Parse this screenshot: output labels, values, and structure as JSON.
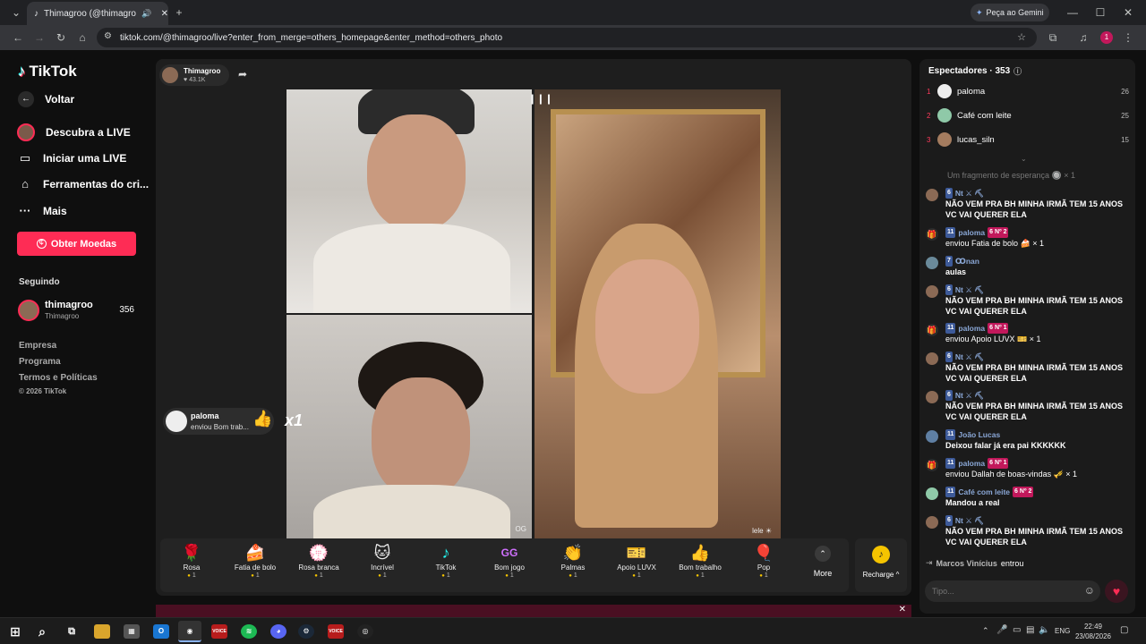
{
  "browser": {
    "tab_title": "Thimagroo (@thimagroo) o",
    "new_tab": "+",
    "gemini": "Peça ao Gemini",
    "url": "tiktok.com/@thimagroo/live?enter_from_merge=others_homepage&enter_method=others_photo",
    "profile_initial": "1"
  },
  "sidebar": {
    "logo": "TikTok",
    "back": "Voltar",
    "items": [
      {
        "label": "Descubra a LIVE",
        "icon": "live-avatar-icon"
      },
      {
        "label": "Iniciar uma LIVE",
        "icon": "video-camera-icon"
      },
      {
        "label": "Ferramentas do cri...",
        "icon": "creator-tools-icon"
      },
      {
        "label": "Mais",
        "icon": "more-dots-icon"
      }
    ],
    "coins_button": "Obter Moedas",
    "following_heading": "Seguindo",
    "following": {
      "name": "thimagroo",
      "handle": "Thimagroo",
      "count": "356"
    },
    "footer": [
      "Empresa",
      "Programa",
      "Termos e Políticas",
      "© 2026 TikTok"
    ]
  },
  "stage": {
    "host_name": "Thimagroo",
    "host_likes": "♥ 43.1K",
    "gift_alert": {
      "user": "paloma",
      "text": "enviou Bom trab...",
      "multiplier": "x1"
    },
    "video_labels": {
      "og": "OG",
      "lele": "lele ☀"
    },
    "gifts": [
      {
        "name": "Rosa",
        "price": "1",
        "icon": "🌹"
      },
      {
        "name": "Fatia de bolo",
        "price": "1",
        "icon": "🍰"
      },
      {
        "name": "Rosa branca",
        "price": "1",
        "icon": "💮"
      },
      {
        "name": "Incrível",
        "price": "1",
        "icon": "🐱"
      },
      {
        "name": "TikTok",
        "price": "1",
        "icon": "♪"
      },
      {
        "name": "Bom jogo",
        "price": "1",
        "icon": "GG"
      },
      {
        "name": "Palmas",
        "price": "1",
        "icon": "👏"
      },
      {
        "name": "Apoio LUVX",
        "price": "1",
        "icon": "🎫"
      },
      {
        "name": "Bom trabalho",
        "price": "1",
        "icon": "👍"
      },
      {
        "name": "Pop",
        "price": "1",
        "icon": "🎈"
      }
    ],
    "more": "More",
    "recharge": "Recharge ^"
  },
  "chat": {
    "viewers_heading": "Espectadores · 353",
    "viewers": [
      {
        "rank": "1",
        "name": "paloma",
        "count": "26"
      },
      {
        "rank": "2",
        "name": "Café com leite",
        "count": "25"
      },
      {
        "rank": "3",
        "name": "lucas_siln",
        "count": "15"
      }
    ],
    "faded_line": "Um fragmento de esperança 🔘 × 1",
    "messages": [
      {
        "level": "6",
        "user": "Nt ⚔ ⛏",
        "text": "NÃO VEM PRA BH MINHA IRMÃ TEM 15 ANOS VC VAI QUERER ELA"
      },
      {
        "level": "11",
        "user": "paloma",
        "rankbadge": "6 Nº 2",
        "text": "enviou Fatia de bolo 🍰 × 1",
        "gift": true
      },
      {
        "level": "7",
        "user": "Ꝏnan",
        "text": "aulas"
      },
      {
        "level": "6",
        "user": "Nt ⚔ ⛏",
        "text": "NÃO VEM PRA BH MINHA IRMÃ TEM 15 ANOS VC VAI QUERER ELA"
      },
      {
        "level": "11",
        "user": "paloma",
        "rankbadge": "6 Nº 1",
        "text": "enviou Apoio LUVX 🎫 × 1",
        "gift": true
      },
      {
        "level": "6",
        "user": "Nt ⚔ ⛏",
        "text": "NÃO VEM PRA BH MINHA IRMÃ TEM 15 ANOS VC VAI QUERER ELA"
      },
      {
        "level": "6",
        "user": "Nt ⚔ ⛏",
        "text": "NÃO VEM PRA BH MINHA IRMÃ TEM 15 ANOS VC VAI QUERER ELA"
      },
      {
        "level": "11",
        "user": "João Lucas",
        "text": "Deixou falar já era pai KKKKKK"
      },
      {
        "level": "11",
        "user": "paloma",
        "rankbadge": "6 Nº 1",
        "text": "enviou Dallah de boas-vindas 🎺 × 1",
        "gift": true
      },
      {
        "level": "11",
        "user": "Café com leite",
        "rankbadge": "6 Nº 2",
        "text": "Mandou a real"
      },
      {
        "level": "6",
        "user": "Nt ⚔ ⛏",
        "text": "NÃO VEM PRA BH MINHA IRMÃ TEM 15 ANOS VC VAI QUERER ELA"
      }
    ],
    "join": {
      "user": "Marcos Vinícius",
      "text": "entrou"
    },
    "input_placeholder": "Tipo..."
  },
  "taskbar": {
    "lang": "ENG",
    "time": "22:49",
    "date": "23/08/2026"
  },
  "colors": {
    "accent": "#fe2c55",
    "panel": "#1b1b1b",
    "badge": "#3d5a99"
  }
}
